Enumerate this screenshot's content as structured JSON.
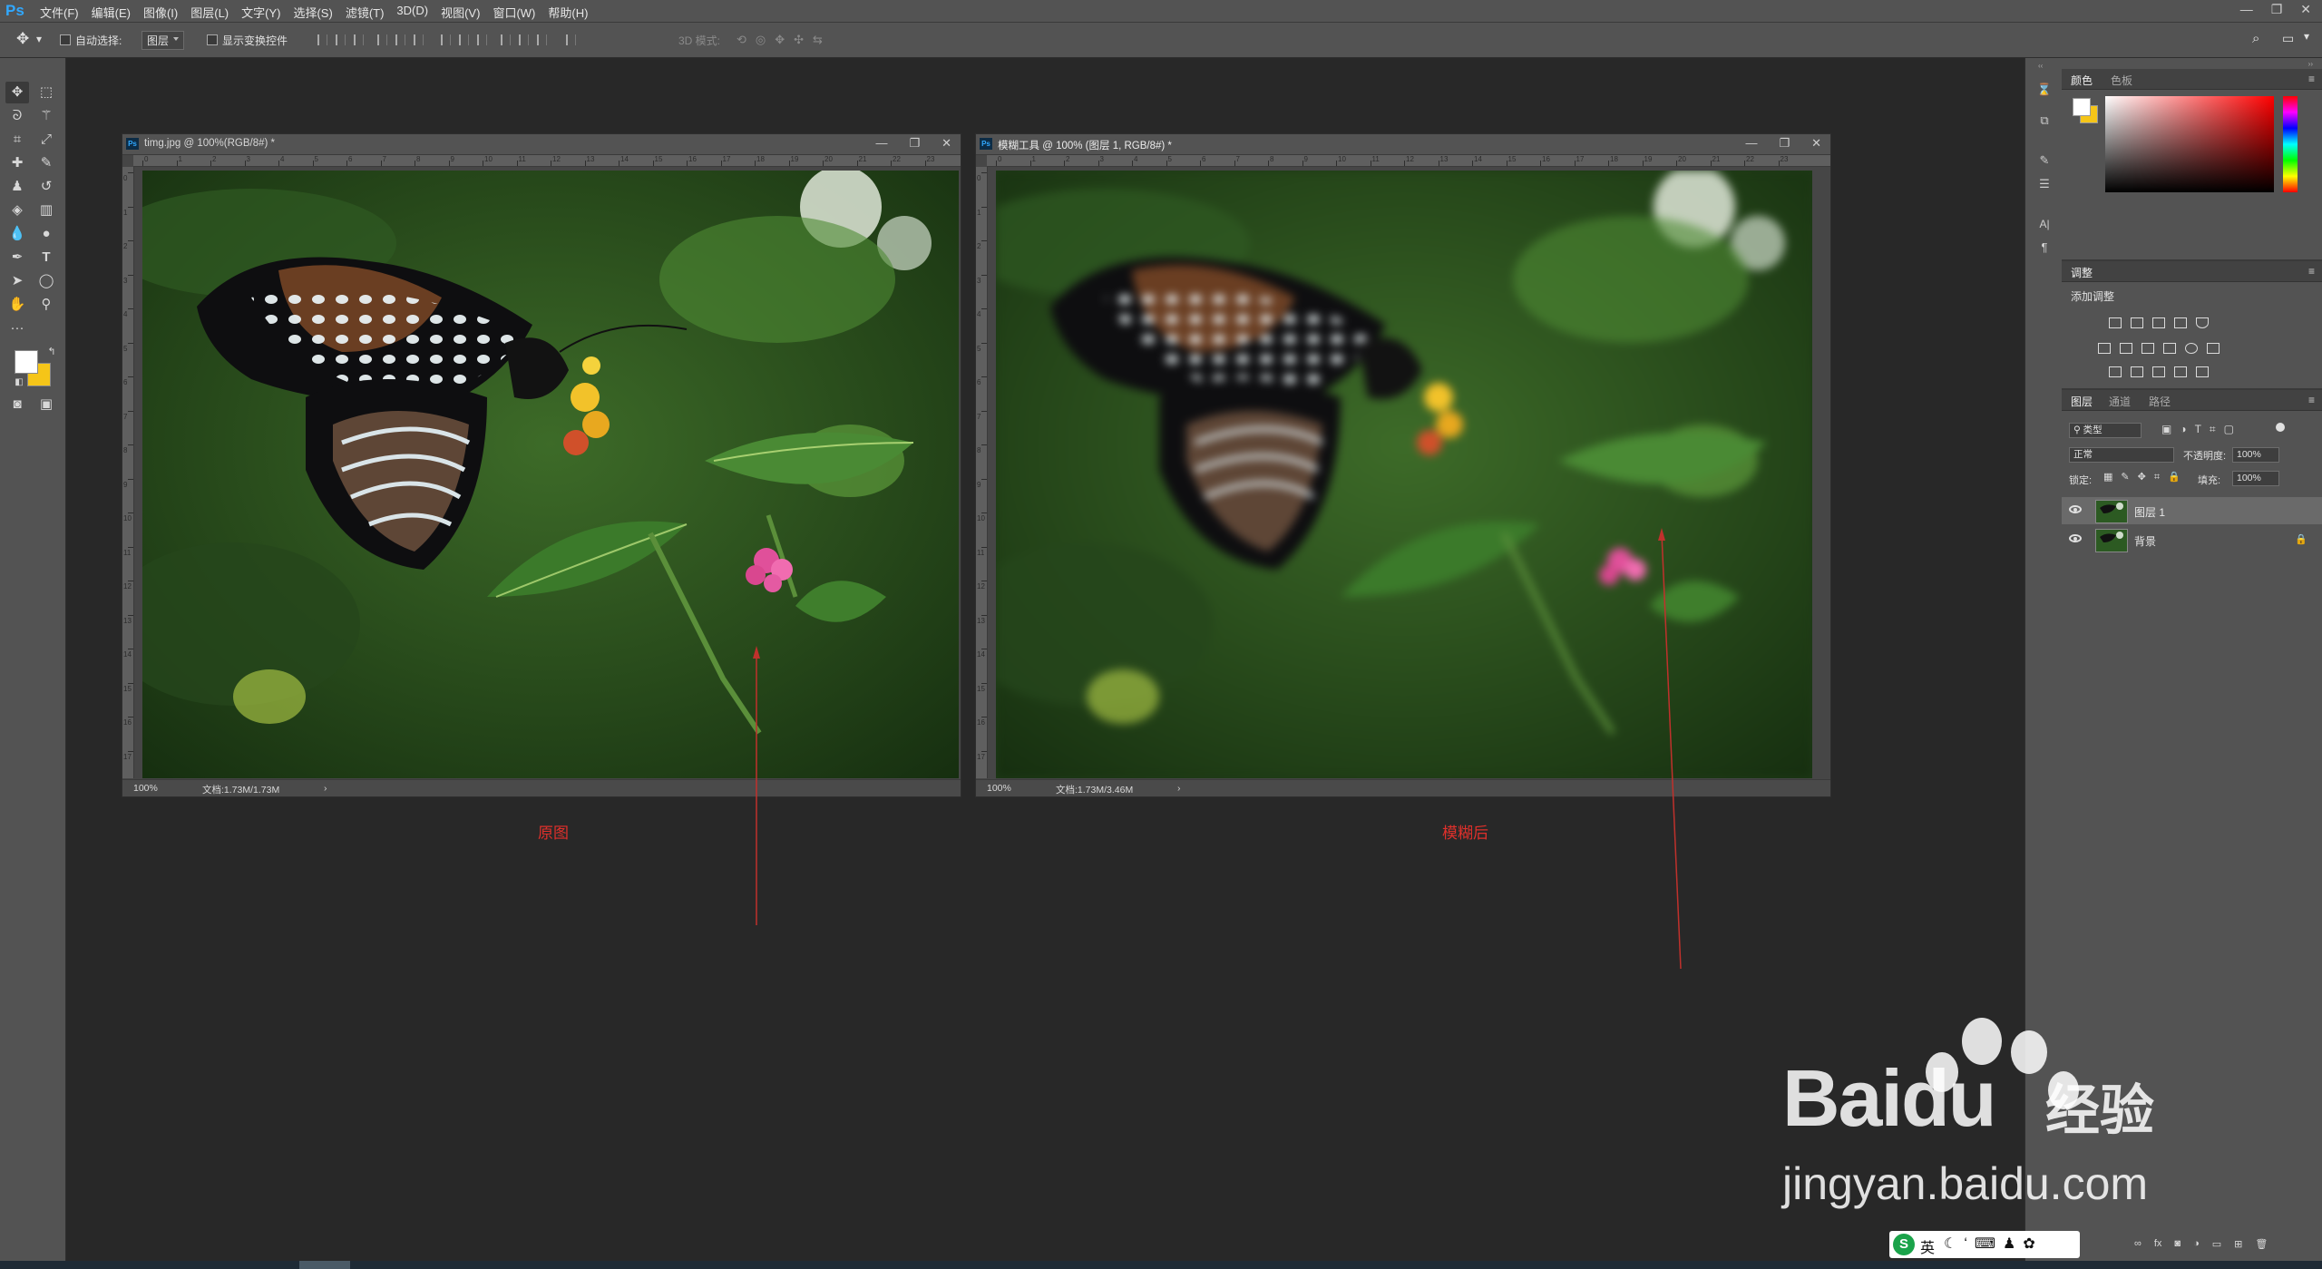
{
  "app": {
    "logo": "Ps"
  },
  "menu": [
    "文件(F)",
    "编辑(E)",
    "图像(I)",
    "图层(L)",
    "文字(Y)",
    "选择(S)",
    "滤镜(T)",
    "3D(D)",
    "视图(V)",
    "窗口(W)",
    "帮助(H)"
  ],
  "window_controls": [
    "—",
    "❐",
    "✕"
  ],
  "options_bar": {
    "auto_select_label": "自动选择:",
    "auto_select_value": "图层",
    "show_transform_label": "显示变换控件",
    "mode_3d_label": "3D 模式:"
  },
  "documents": [
    {
      "title": "timg.jpg @ 100%(RGB/8#) *",
      "zoom": "100%",
      "doc_size": "文档:1.73M/1.73M"
    },
    {
      "title": "模糊工具 @ 100% (图层 1, RGB/8#) *",
      "zoom": "100%",
      "doc_size": "文档:1.73M/3.46M"
    }
  ],
  "ruler_h": [
    "0",
    "1",
    "2",
    "3",
    "4",
    "5",
    "6",
    "7",
    "8",
    "9",
    "10",
    "11",
    "12",
    "13",
    "14",
    "15",
    "16",
    "17",
    "18",
    "19",
    "20",
    "21",
    "22",
    "23"
  ],
  "ruler_v": [
    "0",
    "1",
    "2",
    "3",
    "4",
    "5",
    "6",
    "7",
    "8",
    "9",
    "10",
    "11",
    "12",
    "13",
    "14",
    "15",
    "16",
    "17"
  ],
  "annotations": {
    "left_label": "原图",
    "right_label": "模糊后"
  },
  "color_panel": {
    "tab_active": "颜色",
    "tab_other": "色板"
  },
  "adjust_panel": {
    "tab": "调整",
    "add_label": "添加调整"
  },
  "layers_panel": {
    "tabs": [
      "图层",
      "通道",
      "路径"
    ],
    "filter_kind": "类型",
    "blend_mode": "正常",
    "opacity_label": "不透明度:",
    "opacity_value": "100%",
    "lock_label": "锁定:",
    "fill_label": "填充:",
    "fill_value": "100%",
    "layers": [
      {
        "name": "图层 1",
        "selected": true
      },
      {
        "name": "背景",
        "locked": true
      }
    ],
    "footer_icons": [
      "link-icon",
      "fx-icon",
      "mask-icon",
      "adjustment-icon",
      "group-icon",
      "new-layer-icon",
      "trash-icon"
    ]
  },
  "watermark": {
    "brand": "Baidu",
    "brand_cn": "经验",
    "url": "jingyan.baidu.com"
  },
  "ime": {
    "lang": "英"
  },
  "colors": {
    "ps_blue": "#31a8ff",
    "annotation_red": "#e0302b",
    "foreground_swatch": "#ffffff",
    "background_swatch": "#f5c518"
  }
}
